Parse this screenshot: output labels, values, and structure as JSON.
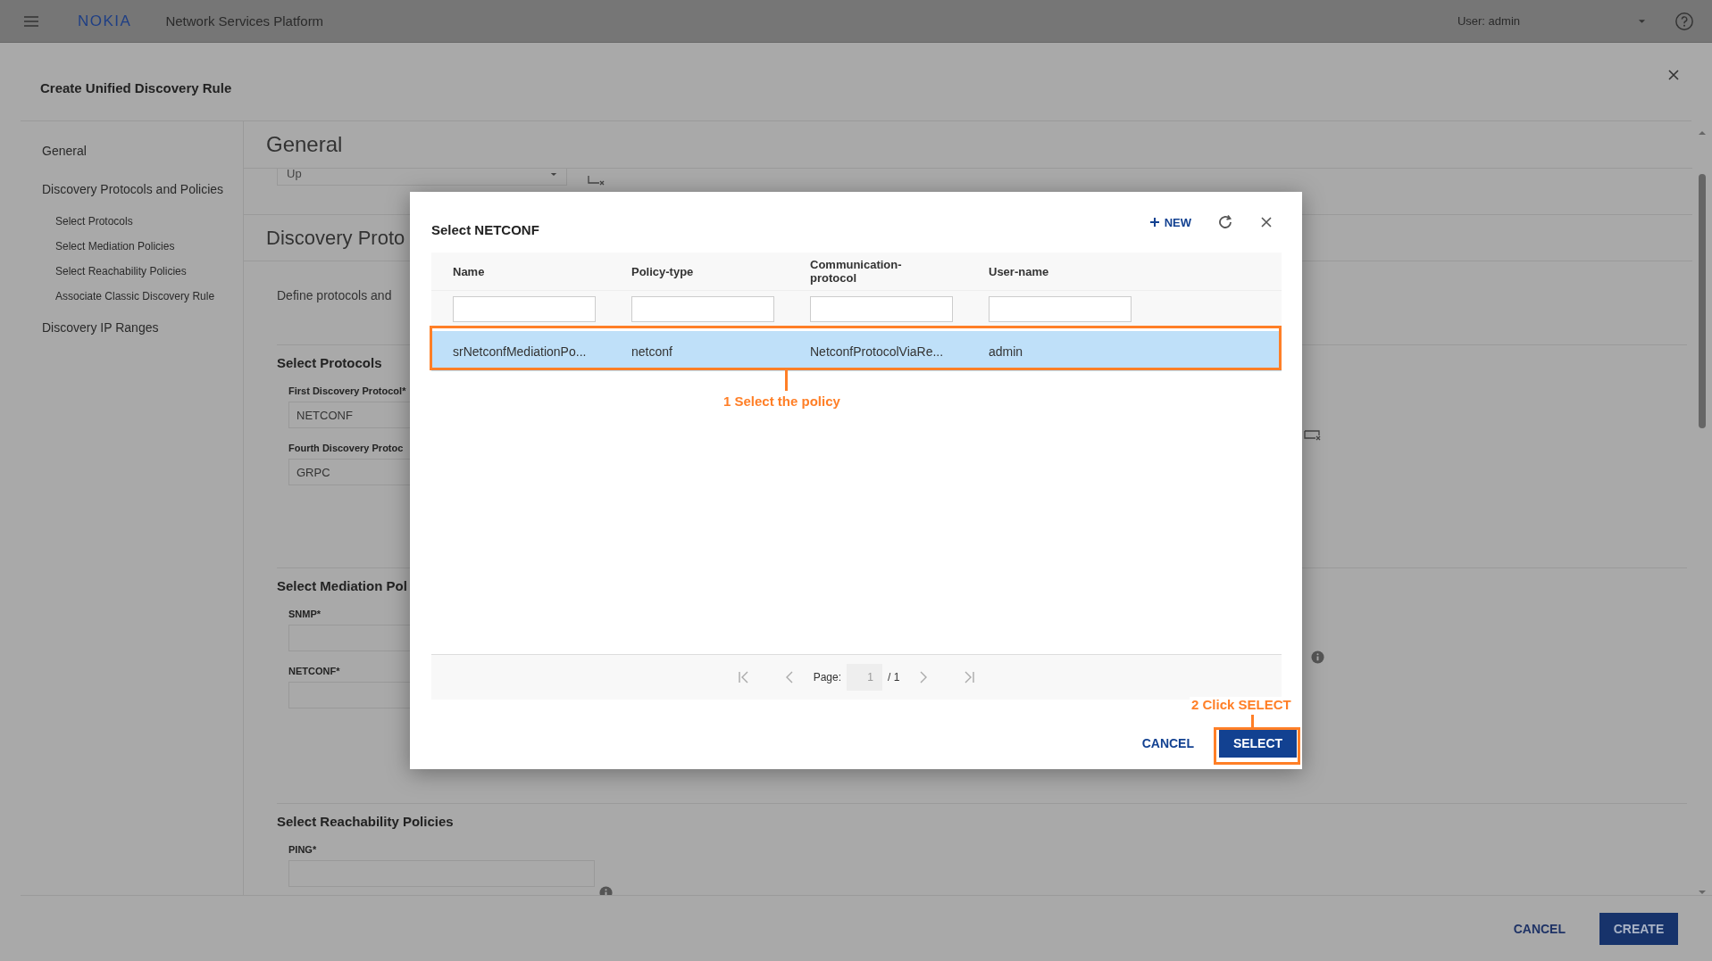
{
  "top_bar": {
    "logo": "NOKIA",
    "title": "Network Services Platform",
    "user": "User: admin"
  },
  "panel": {
    "title": "Create Unified Discovery Rule"
  },
  "nav": [
    {
      "label": "General",
      "selected": false
    },
    {
      "label": "Discovery Protocols and Policies",
      "selected": false,
      "children": [
        {
          "label": "Select Protocols"
        },
        {
          "label": "Select Mediation Policies"
        },
        {
          "label": "Select Reachability Policies"
        },
        {
          "label": "Associate Classic Discovery Rule"
        }
      ]
    },
    {
      "label": "Discovery IP Ranges",
      "selected": false
    }
  ],
  "general": {
    "heading": "General",
    "field_value": "Up"
  },
  "discovery": {
    "heading": "Discovery Proto",
    "description": "Define protocols and",
    "groups": [
      {
        "title": "Select Protocols",
        "fields": [
          {
            "label": "First Discovery Protocol*",
            "value": "NETCONF"
          },
          {
            "label": "Fourth Discovery Protoc",
            "value": "GRPC"
          }
        ]
      },
      {
        "title": "Select Mediation Pol",
        "fields": [
          {
            "label": "SNMP*"
          },
          {
            "label": "NETCONF*"
          }
        ]
      },
      {
        "title": "Select Reachability Policies",
        "fields": [
          {
            "label": "PING*"
          }
        ]
      }
    ]
  },
  "footer": {
    "cancel": "CANCEL",
    "create": "CREATE"
  },
  "dialog": {
    "title": "Select NETCONF",
    "new_label": "NEW",
    "columns": [
      {
        "label": "Name"
      },
      {
        "label": "Policy-type"
      },
      {
        "label": "Communication-protocol"
      },
      {
        "label": "User-name"
      }
    ],
    "rows": [
      {
        "selected": true,
        "cells": [
          "srNetconfMediationPo...",
          "netconf",
          "NetconfProtocolViaRe...",
          "admin"
        ]
      }
    ],
    "pagination": {
      "label": "Page:",
      "page": "1",
      "total": "/ 1"
    },
    "cancel": "CANCEL",
    "select": "SELECT"
  },
  "annotations": [
    {
      "text": "1  Select the policy"
    },
    {
      "text": "2  Click SELECT"
    }
  ]
}
